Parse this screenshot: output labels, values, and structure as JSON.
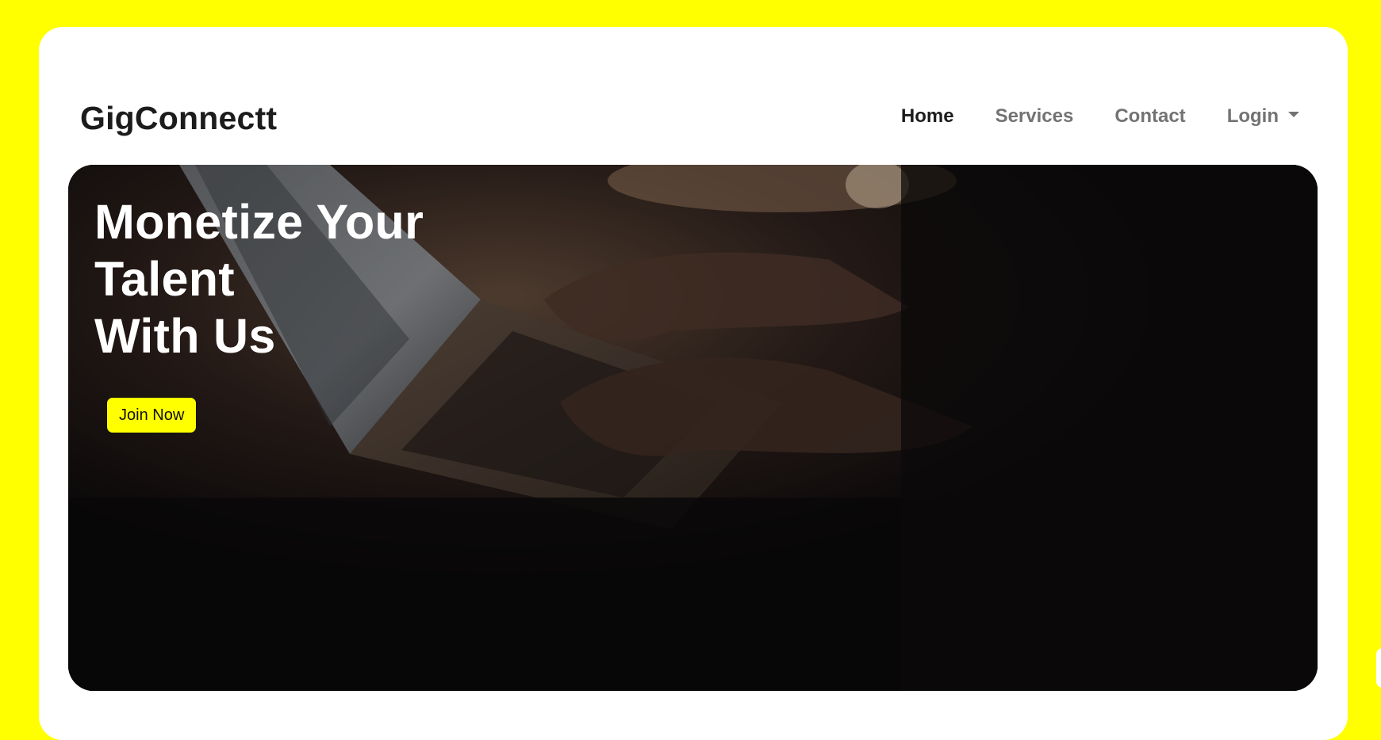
{
  "brand": {
    "name": "GigConnectt"
  },
  "nav": {
    "items": [
      {
        "label": "Home",
        "active": true
      },
      {
        "label": "Services",
        "active": false
      },
      {
        "label": "Contact",
        "active": false
      },
      {
        "label": "Login",
        "active": false,
        "dropdown": true
      }
    ]
  },
  "hero": {
    "title_lines": [
      "Monetize Your",
      "Talent",
      "With Us"
    ],
    "cta_label": "Join Now",
    "image_subject": "hands typing on a laptop displaying code in a dark room"
  },
  "colors": {
    "page_background": "#ffff00",
    "card_background": "#ffffff",
    "accent": "#ffff00",
    "text_dark": "#1c1c1c",
    "text_muted": "#737373",
    "hero_text": "#ffffff"
  }
}
